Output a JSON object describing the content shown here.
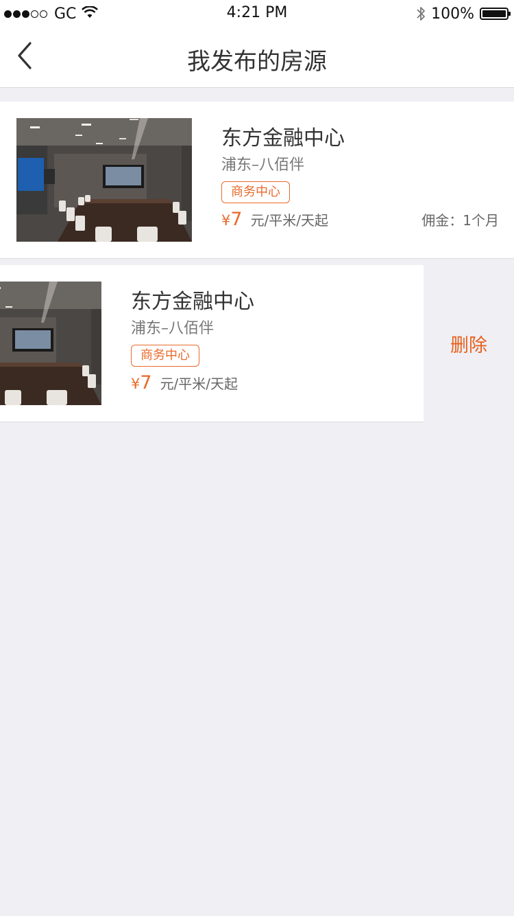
{
  "status_bar": {
    "carrier": "GC",
    "time": "4:21 PM",
    "battery": "100%",
    "icons": [
      "signal-dots-icon",
      "wifi-icon",
      "bluetooth-icon",
      "battery-icon"
    ]
  },
  "nav": {
    "title": "我发布的房源",
    "back_icon": "chevron-left-icon"
  },
  "listings": [
    {
      "title": "东方金融中心",
      "location": "浦东–八佰伴",
      "tag": "商务中心",
      "price_currency": "¥",
      "price": "7",
      "price_unit": "元/平米/天起",
      "commission": "佣金：1个月"
    },
    {
      "title": "东方金融中心",
      "location": "浦东–八佰伴",
      "tag": "商务中心",
      "price_currency": "¥",
      "price": "7",
      "price_unit": "元/平米/天起",
      "delete_label": "删除"
    }
  ],
  "colors": {
    "accent": "#e86a2a",
    "background": "#efeff4",
    "card": "#ffffff"
  }
}
